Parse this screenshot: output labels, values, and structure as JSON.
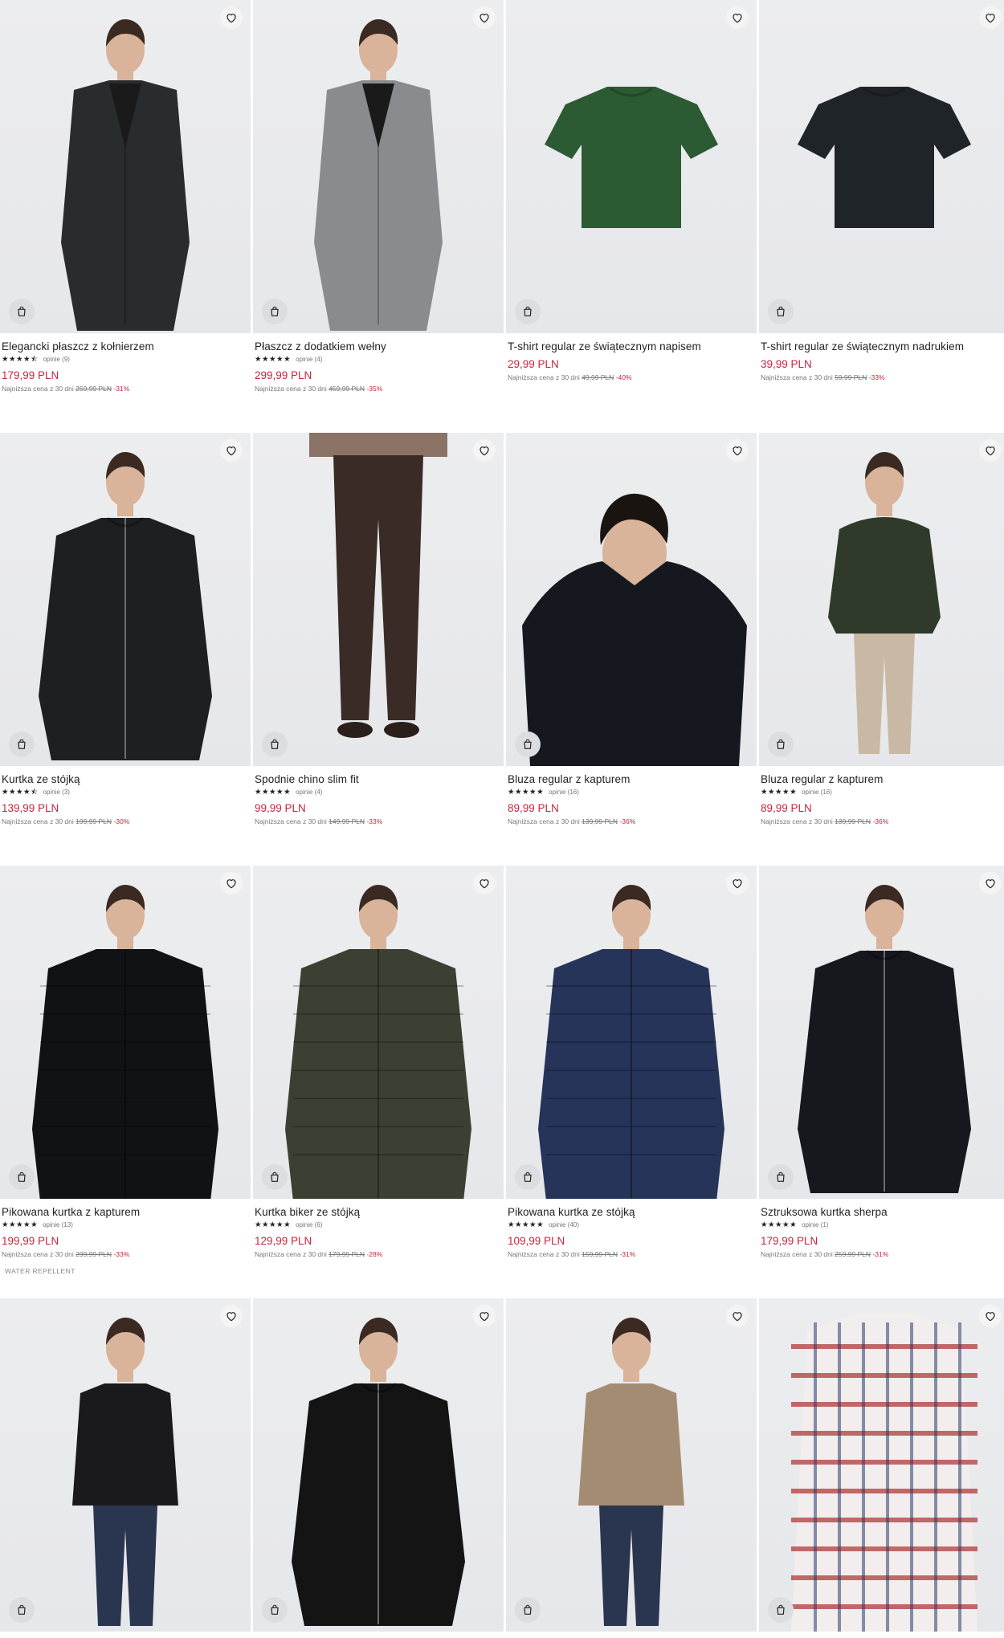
{
  "labels": {
    "lowest_price_prefix": "Najniższa cena z 30 dni"
  },
  "colors": {
    "price": "#c8263a",
    "text": "#222222",
    "muted": "#777777",
    "photo_bg": "#e9eaec"
  },
  "products": [
    {
      "title": "Elegancki płaszcz z kołnierzem",
      "stars": "★★★★⯪",
      "reviews": "opinie (9)",
      "price": "179,99 PLN",
      "old_price": "259,99 PLN",
      "discount": "-31%",
      "badge": "",
      "garment": "coat",
      "garment_color": "#2a2b2d"
    },
    {
      "title": "Płaszcz z dodatkiem wełny",
      "stars": "★★★★★",
      "reviews": "opinie (4)",
      "price": "299,99 PLN",
      "old_price": "459,99 PLN",
      "discount": "-35%",
      "badge": "",
      "garment": "coat",
      "garment_color": "#8a8b8e"
    },
    {
      "title": "T-shirt regular ze świątecznym napisem",
      "stars": "",
      "reviews": "",
      "price": "29,99 PLN",
      "old_price": "49,99 PLN",
      "discount": "-40%",
      "badge": "",
      "garment": "tshirt",
      "garment_color": "#2b5a33"
    },
    {
      "title": "T-shirt regular ze świątecznym nadrukiem",
      "stars": "",
      "reviews": "",
      "price": "39,99 PLN",
      "old_price": "59,99 PLN",
      "discount": "-33%",
      "badge": "",
      "garment": "tshirt",
      "garment_color": "#1f2428"
    },
    {
      "title": "Kurtka ze stójką",
      "stars": "★★★★⯪",
      "reviews": "opinie (3)",
      "price": "139,99 PLN",
      "old_price": "199,99 PLN",
      "discount": "-30%",
      "badge": "",
      "garment": "jacket",
      "garment_color": "#1e1f21"
    },
    {
      "title": "Spodnie chino slim fit",
      "stars": "★★★★★",
      "reviews": "opinie (4)",
      "price": "99,99 PLN",
      "old_price": "149,99 PLN",
      "discount": "-33%",
      "badge": "",
      "garment": "pants",
      "garment_color": "#3a2b26"
    },
    {
      "title": "Bluza regular z kapturem",
      "stars": "★★★★★",
      "reviews": "opinie (16)",
      "price": "89,99 PLN",
      "old_price": "139,99 PLN",
      "discount": "-36%",
      "badge": "",
      "garment": "hoodie",
      "garment_color": "#16181f"
    },
    {
      "title": "Bluza regular z kapturem",
      "stars": "★★★★★",
      "reviews": "opinie (16)",
      "price": "89,99 PLN",
      "old_price": "139,99 PLN",
      "discount": "-36%",
      "badge": "",
      "garment": "hoodie-full",
      "garment_color": "#2f3a2a"
    },
    {
      "title": "Pikowana kurtka z kapturem",
      "stars": "★★★★★",
      "reviews": "opinie (13)",
      "price": "199,99 PLN",
      "old_price": "299,99 PLN",
      "discount": "-33%",
      "badge": "WATER REPELLENT",
      "garment": "puffer",
      "garment_color": "#111215"
    },
    {
      "title": "Kurtka biker ze stójką",
      "stars": "★★★★★",
      "reviews": "opinie (6)",
      "price": "129,99 PLN",
      "old_price": "179,99 PLN",
      "discount": "-28%",
      "badge": "",
      "garment": "puffer",
      "garment_color": "#3b4033"
    },
    {
      "title": "Pikowana kurtka ze stójką",
      "stars": "★★★★★",
      "reviews": "opinie (40)",
      "price": "109,99 PLN",
      "old_price": "159,99 PLN",
      "discount": "-31%",
      "badge": "",
      "garment": "puffer",
      "garment_color": "#26345a"
    },
    {
      "title": "Sztruksowa kurtka sherpa",
      "stars": "★★★★★",
      "reviews": "opinie (1)",
      "price": "179,99 PLN",
      "old_price": "259,99 PLN",
      "discount": "-31%",
      "badge": "",
      "garment": "jacket",
      "garment_color": "#16181d"
    },
    {
      "title": "",
      "stars": "",
      "reviews": "",
      "price": "",
      "old_price": "",
      "discount": "",
      "badge": "",
      "garment": "jacket-full",
      "garment_color": "#1a1a1c"
    },
    {
      "title": "",
      "stars": "",
      "reviews": "",
      "price": "",
      "old_price": "",
      "discount": "",
      "badge": "",
      "garment": "jacket",
      "garment_color": "#141414"
    },
    {
      "title": "",
      "stars": "",
      "reviews": "",
      "price": "",
      "old_price": "",
      "discount": "",
      "badge": "",
      "garment": "jacket-full",
      "garment_color": "#a48c72"
    },
    {
      "title": "",
      "stars": "",
      "reviews": "",
      "price": "",
      "old_price": "",
      "discount": "",
      "badge": "",
      "garment": "shirt",
      "garment_color": "#b23a3a"
    }
  ]
}
